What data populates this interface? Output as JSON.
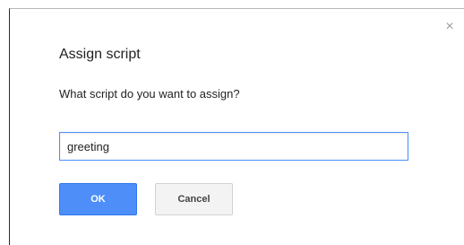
{
  "dialog": {
    "title": "Assign script",
    "close_icon": "close-icon",
    "close_glyph": "×",
    "prompt": "What script do you want to assign?",
    "input_value": "greeting",
    "ok_label": "OK",
    "cancel_label": "Cancel"
  },
  "colors": {
    "primary_button": "#4d8ef8",
    "input_focus_border": "#4d90fe",
    "secondary_button": "#f3f3f3"
  }
}
